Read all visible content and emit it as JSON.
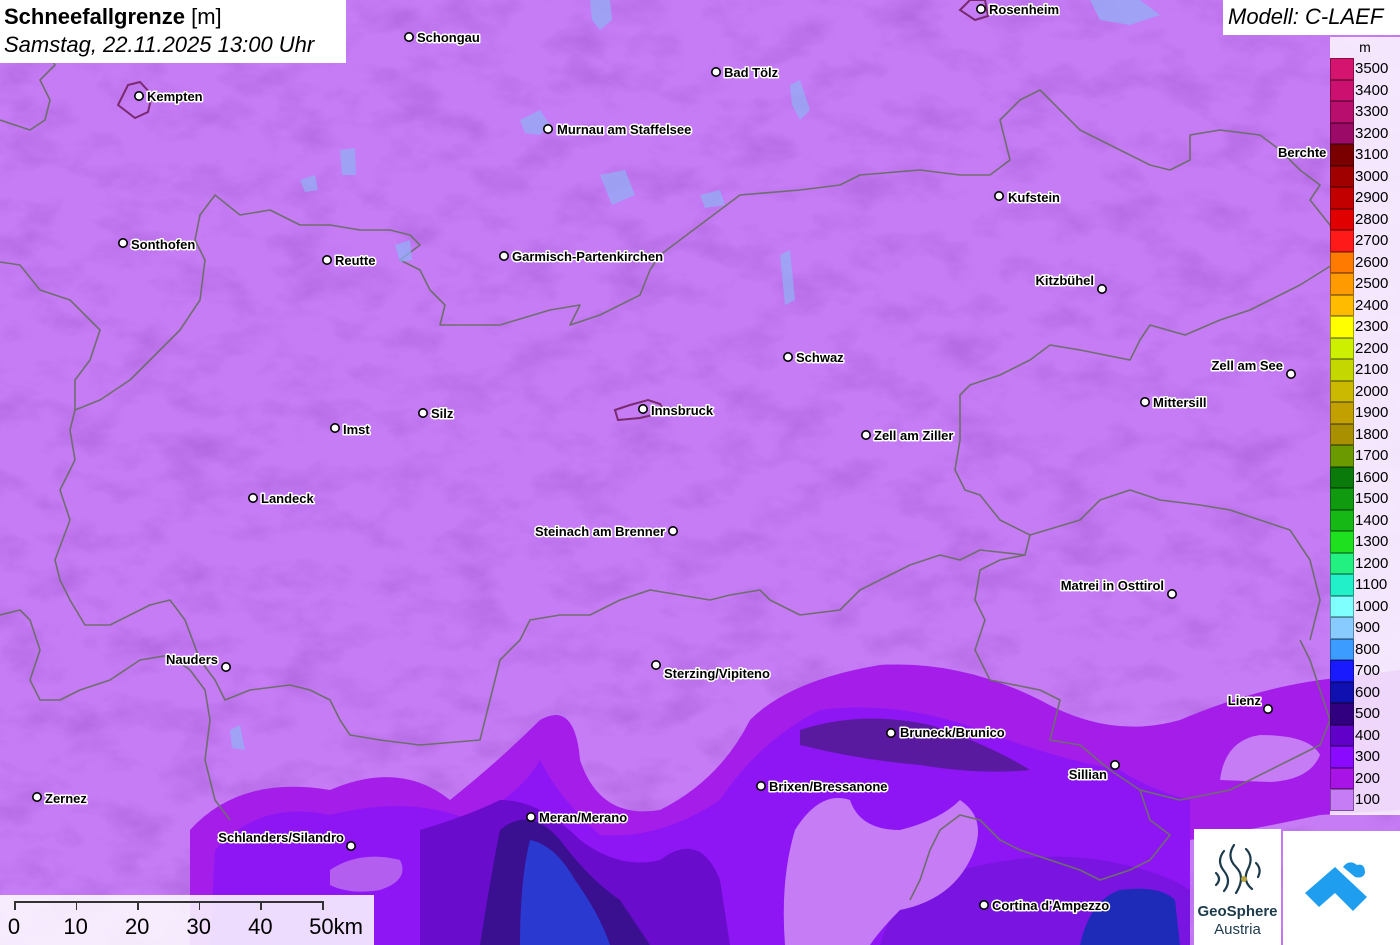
{
  "title": {
    "main": "Schneefallgrenze",
    "unit": "[m]",
    "datetime": "Samstag, 22.11.2025 13:00 Uhr"
  },
  "model_label": "Modell: C-LAEF",
  "legend": {
    "unit": "m",
    "entries": [
      {
        "label": "3500",
        "color": "#d4146e"
      },
      {
        "label": "3400",
        "color": "#cc1070"
      },
      {
        "label": "3300",
        "color": "#b80e6e"
      },
      {
        "label": "3200",
        "color": "#9c0a68"
      },
      {
        "label": "3100",
        "color": "#7a0000"
      },
      {
        "label": "3000",
        "color": "#a00000"
      },
      {
        "label": "2900",
        "color": "#c20000"
      },
      {
        "label": "2800",
        "color": "#e00000"
      },
      {
        "label": "2700",
        "color": "#ff1a1a"
      },
      {
        "label": "2600",
        "color": "#ff7a00"
      },
      {
        "label": "2500",
        "color": "#ff9a00"
      },
      {
        "label": "2400",
        "color": "#ffbb00"
      },
      {
        "label": "2300",
        "color": "#ffff00"
      },
      {
        "label": "2200",
        "color": "#ccf000"
      },
      {
        "label": "2100",
        "color": "#c4d800"
      },
      {
        "label": "2000",
        "color": "#cbb800"
      },
      {
        "label": "1900",
        "color": "#c2a000"
      },
      {
        "label": "1800",
        "color": "#a89000"
      },
      {
        "label": "1700",
        "color": "#6a9a00"
      },
      {
        "label": "1600",
        "color": "#0a7a0a"
      },
      {
        "label": "1500",
        "color": "#109a10"
      },
      {
        "label": "1400",
        "color": "#16b816"
      },
      {
        "label": "1300",
        "color": "#1ee01e"
      },
      {
        "label": "1200",
        "color": "#22f080"
      },
      {
        "label": "1100",
        "color": "#22f0c8"
      },
      {
        "label": "1000",
        "color": "#80ffff"
      },
      {
        "label": "900",
        "color": "#88ccff"
      },
      {
        "label": "800",
        "color": "#3c9cff"
      },
      {
        "label": "700",
        "color": "#1a1aff"
      },
      {
        "label": "600",
        "color": "#1010b0"
      },
      {
        "label": "500",
        "color": "#300080"
      },
      {
        "label": "400",
        "color": "#6000c8"
      },
      {
        "label": "300",
        "color": "#8a0aff"
      },
      {
        "label": "200",
        "color": "#a814e6"
      },
      {
        "label": "100",
        "color": "#c57cf5"
      }
    ]
  },
  "scale_bar": {
    "labels": [
      "0",
      "10",
      "20",
      "30",
      "40",
      "50km"
    ]
  },
  "cities": [
    {
      "name": "Rosenheim"
    },
    {
      "name": "Schongau"
    },
    {
      "name": "Kempten"
    },
    {
      "name": "Bad Tölz"
    },
    {
      "name": "Murnau am Staffelsee"
    },
    {
      "name": "Berchte"
    },
    {
      "name": "Kufstein"
    },
    {
      "name": "Sonthofen"
    },
    {
      "name": "Reutte"
    },
    {
      "name": "Garmisch-Partenkirchen"
    },
    {
      "name": "Kitzbühel"
    },
    {
      "name": "Schwaz"
    },
    {
      "name": "Zell am See"
    },
    {
      "name": "Mittersill"
    },
    {
      "name": "Silz"
    },
    {
      "name": "Innsbruck"
    },
    {
      "name": "Imst"
    },
    {
      "name": "Zell am Ziller"
    },
    {
      "name": "Landeck"
    },
    {
      "name": "Steinach am Brenner"
    },
    {
      "name": "Matrei in Osttirol"
    },
    {
      "name": "Nauders"
    },
    {
      "name": "Sterzing/Vipiteno"
    },
    {
      "name": "Lienz"
    },
    {
      "name": "Bruneck/Brunico"
    },
    {
      "name": "Sillian"
    },
    {
      "name": "Brixen/Bressanone"
    },
    {
      "name": "Zernez"
    },
    {
      "name": "Meran/Merano"
    },
    {
      "name": "Schlanders/Silandro"
    },
    {
      "name": "Cortina d'Ampezzo"
    }
  ],
  "logo": {
    "name_line1": "GeoSphere",
    "name_line2": "Austria"
  },
  "colors": {
    "background_100": "#c57cf5",
    "border": "#6e6e6e"
  }
}
